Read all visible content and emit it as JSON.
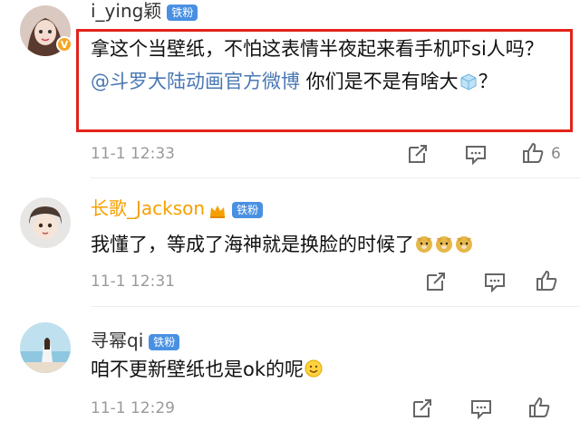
{
  "comments": [
    {
      "username": "i_ying颖",
      "fan_badge": "铁粉",
      "verified_badge": "V",
      "text_part1": "拿这个当壁纸，不怕这表情半夜起来看手机吓si人吗？",
      "mention": "@斗罗大陆动画官方微博",
      "text_part2": " 你们是不是有啥大",
      "text_part3": "？",
      "time": "11-1 12:33",
      "like_count": "6"
    },
    {
      "username": "长歌_Jackson",
      "fan_badge": "铁粉",
      "text": "我懂了，等成了海神就是换脸的时候了",
      "time": "11-1 12:31",
      "like_count": ""
    },
    {
      "username": "寻幂qi",
      "fan_badge": "铁粉",
      "text": "咱不更新壁纸也是ok的呢",
      "time": "11-1 12:29",
      "like_count": ""
    }
  ],
  "icons": {
    "share": "share-icon",
    "comment": "comment-icon",
    "like": "thumbs-up-icon"
  },
  "colors": {
    "highlight_border": "#e2231a",
    "mention": "#4a78b4",
    "fan_badge": "#4a90e2",
    "gold_name": "#f5a000"
  }
}
